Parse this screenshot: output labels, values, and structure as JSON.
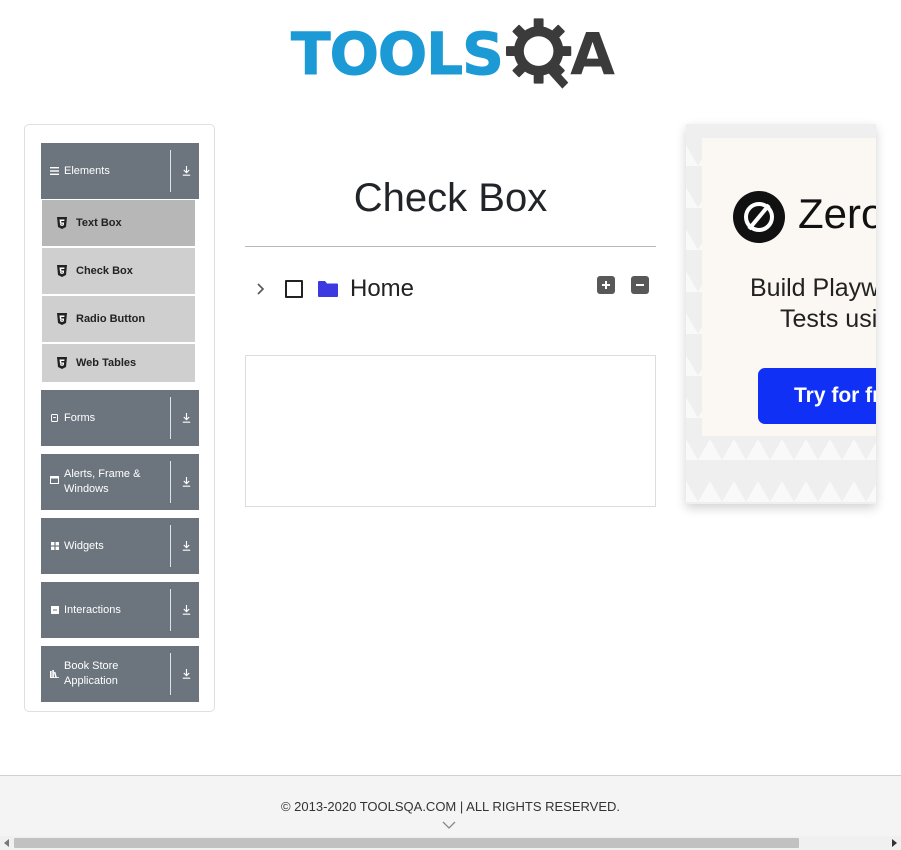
{
  "header": {
    "logo_text_primary": "TOOLS",
    "logo_text_secondary": "A",
    "logo_icon": "magnifier-gear-icon",
    "colors": {
      "brand_blue": "#1c9ad6",
      "brand_dark": "#3b3b3b"
    }
  },
  "sidebar": {
    "groups": [
      {
        "label": "Elements",
        "icon": "hamburger-icon"
      },
      {
        "label": "Forms",
        "icon": "form-icon"
      },
      {
        "label": "Alerts, Frame & Windows",
        "icon": "window-icon"
      },
      {
        "label": "Widgets",
        "icon": "widgets-icon"
      },
      {
        "label": "Interactions",
        "icon": "interactions-icon"
      },
      {
        "label": "Book Store Application",
        "icon": "bookstore-icon"
      }
    ],
    "elements_items": [
      {
        "label": "Text Box",
        "icon": "html5-icon"
      },
      {
        "label": "Check Box",
        "icon": "html5-icon"
      },
      {
        "label": "Radio Button",
        "icon": "html5-icon"
      },
      {
        "label": "Web Tables",
        "icon": "html5-icon"
      }
    ],
    "colors": {
      "group_bg": "#6c757d",
      "item_bg": "#cfcfcf",
      "item_hover_bg": "#b7b7b7"
    }
  },
  "main": {
    "title": "Check Box",
    "tree": {
      "root_label": "Home",
      "expanded": false,
      "checked": false,
      "expand_all_icon": "plus-square-icon",
      "collapse_all_icon": "minus-square-icon",
      "folder_color": "#3d39e0"
    }
  },
  "ad": {
    "brand": "ZeroS",
    "line1": "Build Playwr",
    "line2": "Tests using",
    "cta": "Try for free",
    "cta_color": "#1130f5"
  },
  "footer": {
    "copyright": "© 2013-2020 TOOLSQA.COM | ALL RIGHTS RESERVED."
  }
}
